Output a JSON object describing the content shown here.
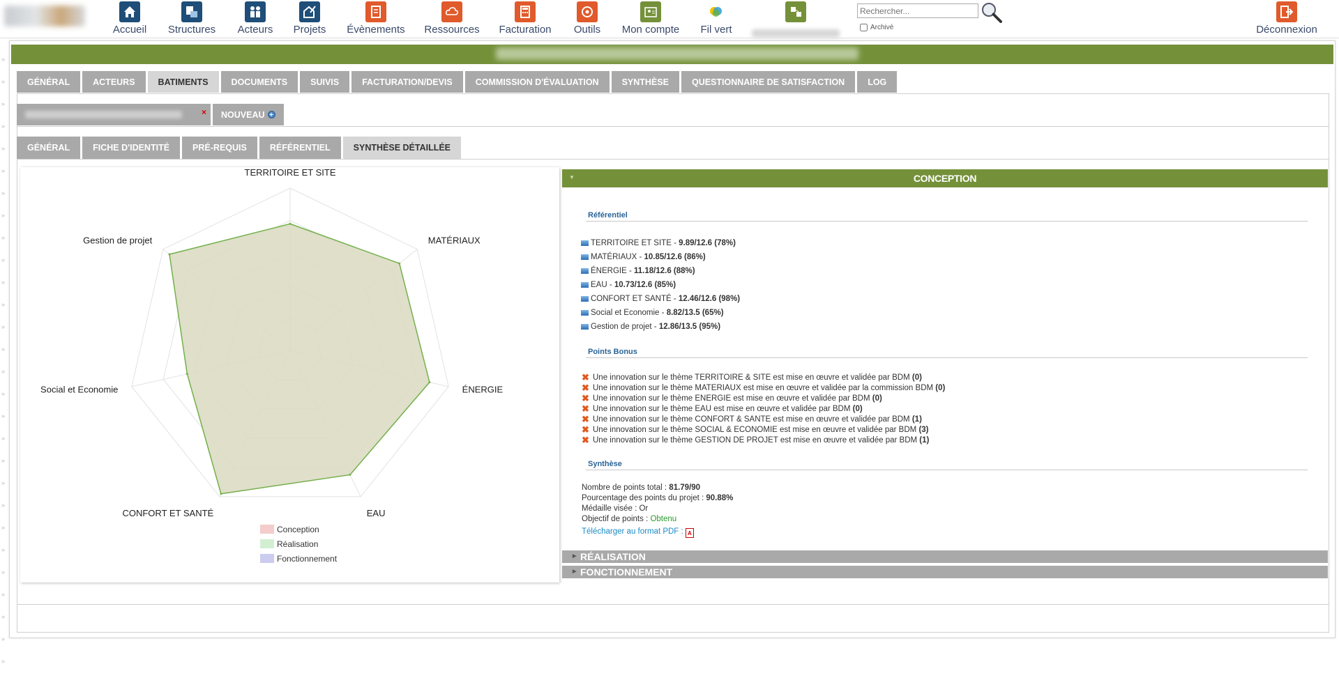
{
  "nav": {
    "items": [
      {
        "label": "Accueil",
        "icon": "home-icon",
        "color": "#1f4e79"
      },
      {
        "label": "Structures",
        "icon": "structures-icon",
        "color": "#1f4e79"
      },
      {
        "label": "Acteurs",
        "icon": "people-icon",
        "color": "#1f4e79"
      },
      {
        "label": "Projets",
        "icon": "projects-icon",
        "color": "#1f4e79"
      },
      {
        "label": "Évènements",
        "icon": "events-icon",
        "color": "#e05a2b"
      },
      {
        "label": "Ressources",
        "icon": "cloud-icon",
        "color": "#e05a2b"
      },
      {
        "label": "Facturation",
        "icon": "calculator-icon",
        "color": "#e05a2b"
      },
      {
        "label": "Outils",
        "icon": "tools-icon",
        "color": "#e05a2b"
      },
      {
        "label": "Mon compte",
        "icon": "account-icon",
        "color": "#74913a"
      },
      {
        "label": "Fil vert",
        "icon": "fil-vert-icon",
        "color": "#ffffff"
      },
      {
        "label": "",
        "icon": "extra-module-icon",
        "color": "#74913a"
      }
    ],
    "search_placeholder": "Rechercher...",
    "archive_label": "Archivé",
    "logout_label": "Déconnexion"
  },
  "tabs": [
    "GÉNÉRAL",
    "ACTEURS",
    "BATIMENTS",
    "DOCUMENTS",
    "SUIVIS",
    "FACTURATION/DEVIS",
    "COMMISSION D'ÉVALUATION",
    "SYNTHÈSE",
    "QUESTIONNAIRE DE SATISFACTION",
    "LOG"
  ],
  "active_tab": "BATIMENTS",
  "building_tabs": {
    "close": "×",
    "new_label": "NOUVEAU",
    "plus": "+"
  },
  "sub_tabs": [
    "GÉNÉRAL",
    "FICHE D'IDENTITÉ",
    "PRÉ-REQUIS",
    "RÉFÉRENTIEL",
    "SYNTHÈSE DÉTAILLÉE"
  ],
  "active_sub_tab": "SYNTHÈSE DÉTAILLÉE",
  "chart_data": {
    "type": "radar",
    "axes": [
      "TERRITOIRE ET SITE",
      "MATÉRIAUX",
      "ÉNERGIE",
      "EAU",
      "CONFORT ET SANTÉ",
      "Social et Economie",
      "Gestion de projet"
    ],
    "series": [
      {
        "name": "Conception",
        "values": [
          78,
          86,
          88,
          85,
          98,
          65,
          95
        ],
        "color": "#74b04a",
        "fill": "#dcdcc4"
      }
    ],
    "range": [
      0,
      100
    ],
    "rings": 5,
    "legend": [
      {
        "name": "Conception",
        "color": "#f4cccc"
      },
      {
        "name": "Réalisation",
        "color": "#d2efd2"
      },
      {
        "name": "Fonctionnement",
        "color": "#ccccf0"
      }
    ],
    "legend_position": "bottom"
  },
  "details": {
    "conception_title": "CONCEPTION",
    "referentiel_title": "Référentiel",
    "referentiel": [
      {
        "name": "TERRITOIRE ET SITE",
        "score": "9.89/12.6 (78%)"
      },
      {
        "name": "MATÉRIAUX",
        "score": "10.85/12.6 (86%)"
      },
      {
        "name": "ÉNERGIE",
        "score": "11.18/12.6 (88%)"
      },
      {
        "name": "EAU",
        "score": "10.73/12.6 (85%)"
      },
      {
        "name": "CONFORT ET SANTÉ",
        "score": "12.46/12.6 (98%)"
      },
      {
        "name": "Social et Economie",
        "score": "8.82/13.5 (65%)"
      },
      {
        "name": "Gestion de projet",
        "score": "12.86/13.5 (95%)"
      }
    ],
    "bonus_title": "Points Bonus",
    "bonus": [
      {
        "text": "Une innovation sur le thème TERRITOIRE & SITE est mise en œuvre et validée par BDM",
        "value": "(0)"
      },
      {
        "text": "Une innovation sur le thème MATERIAUX est mise en œuvre et validée par la commission BDM",
        "value": "(0)"
      },
      {
        "text": "Une innovation sur le thème ENERGIE est mise en œuvre et validée par BDM",
        "value": "(0)"
      },
      {
        "text": "Une innovation sur le thème EAU est mise en œuvre et validée par BDM",
        "value": "(0)"
      },
      {
        "text": "Une innovation sur le thème CONFORT & SANTE est mise en œuvre et validée par BDM",
        "value": "(1)"
      },
      {
        "text": "Une innovation sur le thème SOCIAL & ECONOMIE est mise en œuvre et validée par BDM",
        "value": "(3)"
      },
      {
        "text": "Une innovation sur le thème GESTION DE PROJET est mise en œuvre et validée par BDM",
        "value": "(1)"
      }
    ],
    "synthese_title": "Synthèse",
    "total_label": "Nombre de points total : ",
    "total_value": "81.79/90",
    "percent_label": "Pourcentage des points du projet : ",
    "percent_value": "90.88%",
    "medal_label": "Médaille visée : ",
    "medal_value": "Or",
    "objective_label": "Objectif de points : ",
    "objective_value": "Obtenu",
    "objective_color": "#2a9a2a",
    "pdf_label": "Télécharger au format PDF : ",
    "pdf_icon": "pdf-icon",
    "realisation_title": "RÉALISATION",
    "fonctionnement_title": "FONCTIONNEMENT"
  }
}
